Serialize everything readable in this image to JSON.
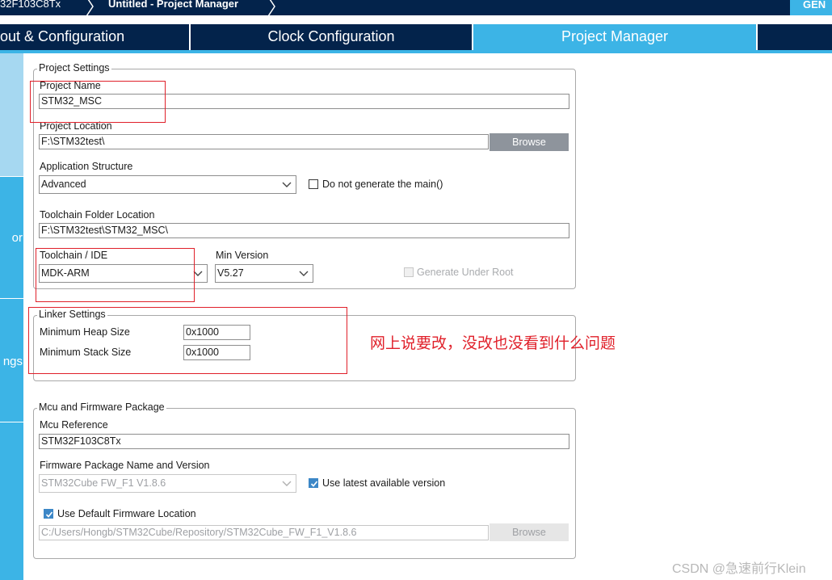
{
  "breadcrumb": {
    "mcu": "32F103C8Tx",
    "project": "Untitled - Project Manager",
    "generate_label": "GEN"
  },
  "tabs": [
    {
      "label": "out & Configuration"
    },
    {
      "label": "Clock Configuration"
    },
    {
      "label": "Project Manager",
      "active": true
    }
  ],
  "sidebar": {
    "items": [
      {
        "label": ""
      },
      {
        "label": "or"
      },
      {
        "label": "ngs"
      }
    ]
  },
  "project_settings": {
    "title": "Project Settings",
    "project_name_label": "Project Name",
    "project_name_value": "STM32_MSC",
    "project_location_label": "Project Location",
    "project_location_value": "F:\\STM32test\\",
    "browse_label": "Browse",
    "app_structure_label": "Application Structure",
    "app_structure_value": "Advanced",
    "no_main_label": "Do not generate the main()",
    "toolchain_folder_label": "Toolchain Folder Location",
    "toolchain_folder_value": "F:\\STM32test\\STM32_MSC\\",
    "toolchain_label": "Toolchain / IDE",
    "toolchain_value": "MDK-ARM",
    "min_version_label": "Min Version",
    "min_version_value": "V5.27",
    "generate_under_root_label": "Generate Under Root"
  },
  "linker_settings": {
    "title": "Linker Settings",
    "heap_label": "Minimum Heap Size",
    "heap_value": "0x1000",
    "stack_label": "Minimum Stack Size",
    "stack_value": "0x1000"
  },
  "mcu_package": {
    "title": "Mcu and Firmware Package",
    "mcu_ref_label": "Mcu Reference",
    "mcu_ref_value": "STM32F103C8Tx",
    "fw_label": "Firmware Package Name and Version",
    "fw_value": "STM32Cube FW_F1 V1.8.6",
    "use_latest_label": "Use latest available version",
    "use_default_label": "Use Default Firmware Location",
    "fw_location_value": "C:/Users/Hongb/STM32Cube/Repository/STM32Cube_FW_F1_V1.8.6",
    "browse_label": "Browse"
  },
  "annotation": {
    "note": "网上说要改，没改也没看到什么问题"
  },
  "watermark": "CSDN @急速前行Klein",
  "colors": {
    "nav_dark": "#03234b",
    "accent": "#3cb4e6",
    "annotation_red": "#e0202a"
  }
}
